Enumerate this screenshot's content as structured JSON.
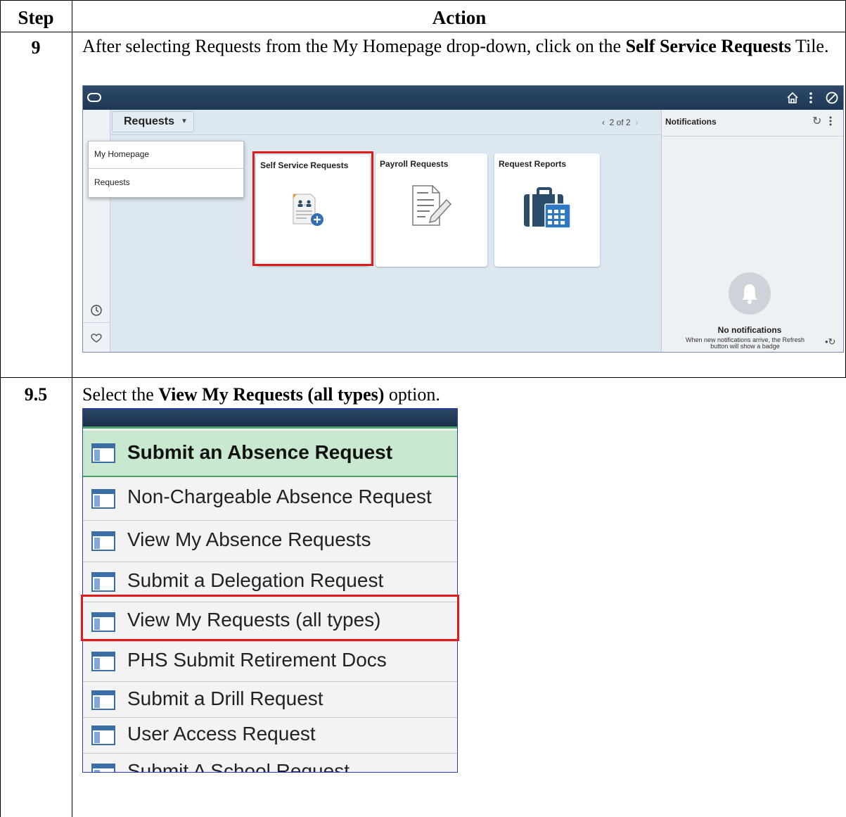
{
  "table": {
    "headers": {
      "step": "Step",
      "action": "Action"
    },
    "rows": [
      {
        "step": "9",
        "text_before": "After selecting Requests from the My Homepage drop-down, click on the ",
        "text_bold": "Self Service Requests",
        "text_after": " Tile."
      },
      {
        "step": "9.5",
        "text_before": "Select the ",
        "text_bold": "View My Requests (all types)",
        "text_after": " option."
      }
    ]
  },
  "screenshot1": {
    "dropdown_label": "Requests",
    "pager": "2 of 2",
    "menu_items": [
      "My Homepage",
      "Requests"
    ],
    "tiles": [
      {
        "title": "Self Service Requests",
        "highlighted": true
      },
      {
        "title": "Payroll Requests",
        "highlighted": false
      },
      {
        "title": "Request Reports",
        "highlighted": false
      }
    ],
    "notifications": {
      "title": "Notifications",
      "empty_title": "No notifications",
      "empty_text_line1": "When new notifications arrive, the Refresh",
      "empty_text_line2": "button will show a badge"
    },
    "colors": {
      "topbar": "#24405f",
      "highlight": "#e01b1b",
      "background": "#dde7f0"
    }
  },
  "screenshot2": {
    "items": [
      {
        "label": "Submit an Absence Request",
        "selected": true
      },
      {
        "label": "Non-Chargeable Absence Request",
        "selected": false
      },
      {
        "label": "View My Absence Requests",
        "selected": false
      },
      {
        "label": "Submit a Delegation Request",
        "selected": false
      },
      {
        "label": "View My Requests (all types)",
        "selected": false,
        "highlighted": true
      },
      {
        "label": "PHS Submit Retirement Docs",
        "selected": false
      },
      {
        "label": "Submit a Drill Request",
        "selected": false
      },
      {
        "label": "User Access Request",
        "selected": false
      },
      {
        "label": "Submit A School Request",
        "selected": false
      }
    ],
    "colors": {
      "header": "#1e3650",
      "selected_bg": "#c8e8cf",
      "highlight": "#e01b1b"
    }
  }
}
